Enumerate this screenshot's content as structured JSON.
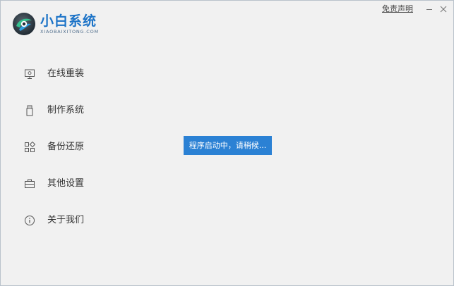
{
  "app": {
    "name": "小白系统",
    "subtitle": "XIAOBAIXITONG.COM"
  },
  "header": {
    "disclaimer_label": "免责声明"
  },
  "sidebar": {
    "items": [
      {
        "label": "在线重装",
        "icon": "monitor-icon"
      },
      {
        "label": "制作系统",
        "icon": "usb-drive-icon"
      },
      {
        "label": "备份还原",
        "icon": "grid-blocks-icon"
      },
      {
        "label": "其他设置",
        "icon": "briefcase-icon"
      },
      {
        "label": "关于我们",
        "icon": "info-icon"
      }
    ]
  },
  "status": {
    "message": "程序启动中，请稍候..."
  },
  "colors": {
    "brand": "#1c73c7",
    "toast": "#2b81d4",
    "background": "#f1f1f1"
  }
}
